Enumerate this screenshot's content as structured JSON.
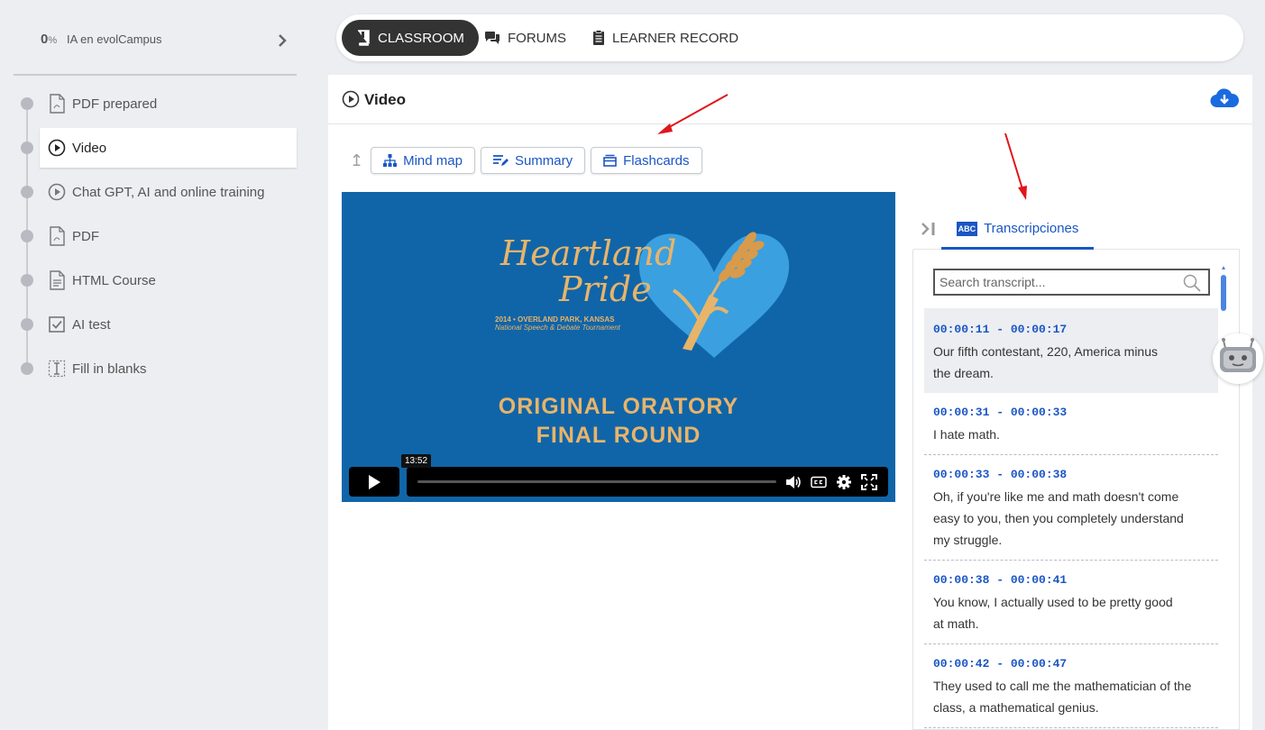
{
  "sidebar": {
    "progress": "0",
    "progress_unit": "%",
    "course_name": "IA en evolCampus",
    "lessons": [
      {
        "label": "PDF prepared",
        "icon": "pdf-icon"
      },
      {
        "label": "Video",
        "icon": "play-circle-icon",
        "active": true
      },
      {
        "label": "Chat GPT, AI and online training",
        "icon": "play-circle-icon"
      },
      {
        "label": "PDF",
        "icon": "pdf-icon"
      },
      {
        "label": "HTML Course",
        "icon": "document-icon"
      },
      {
        "label": "AI test",
        "icon": "checkbox-icon"
      },
      {
        "label": "Fill in blanks",
        "icon": "text-cursor-icon"
      }
    ]
  },
  "topnav": {
    "classroom": "CLASSROOM",
    "forums": "FORUMS",
    "learner_record": "LEARNER RECORD"
  },
  "panel": {
    "title": "Video",
    "tools": {
      "mindmap": "Mind map",
      "summary": "Summary",
      "flashcards": "Flashcards"
    }
  },
  "video": {
    "script_line1": "Heartland",
    "script_line2": "Pride",
    "sub_line1": "2014 • OVERLAND PARK, KANSAS",
    "sub_line2": "National Speech & Debate Tournament",
    "title_line1": "ORIGINAL ORATORY",
    "title_line2": "FINAL ROUND",
    "hover_time": "13:52"
  },
  "transcript": {
    "tab_label": "Transcripciones",
    "abc": "ABC",
    "search_placeholder": "Search transcript...",
    "segments": [
      {
        "time": "00:00:11 - 00:00:17",
        "text": "Our fifth contestant, 220, America minus the dream."
      },
      {
        "time": "00:00:31 - 00:00:33",
        "text": "I hate math."
      },
      {
        "time": "00:00:33 - 00:00:38",
        "text": "Oh, if you're like me and math doesn't come easy to you, then you completely understand my struggle."
      },
      {
        "time": "00:00:38 - 00:00:41",
        "text": "You know, I actually used to be pretty good at math."
      },
      {
        "time": "00:00:42 - 00:00:47",
        "text": "They used to call me the mathematician of the class, a mathematical genius."
      }
    ]
  },
  "colors": {
    "accent": "#1a56c4",
    "video_bg": "#1065a8",
    "logo_gold": "#e8b46a",
    "annotation_arrow": "#e0161b"
  }
}
